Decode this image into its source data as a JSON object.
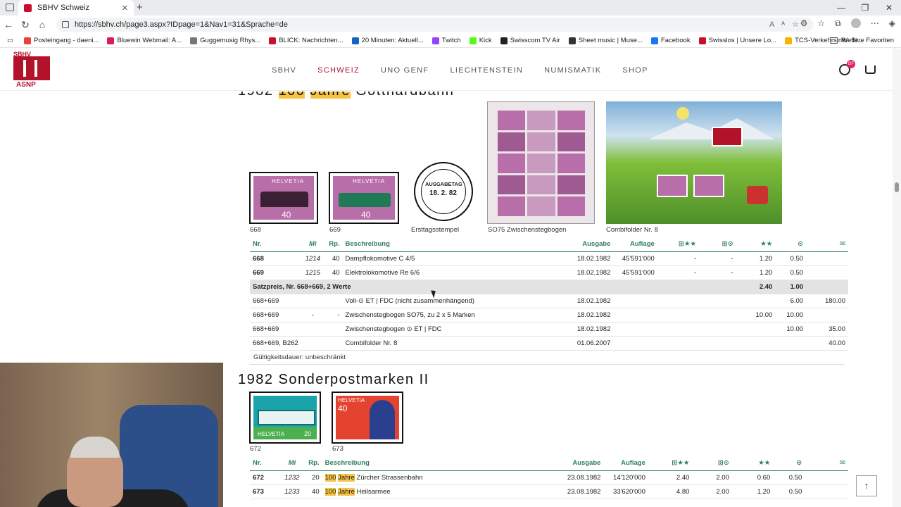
{
  "browser": {
    "tab_title": "SBHV Schweiz",
    "url": "https://sbhv.ch/page3.aspx?IDpage=1&Nav1=31&Sprache=de",
    "bookmarks": [
      "Posteingang - daeni...",
      "Bluewin Webmail: A...",
      "Guggemusig Rhys...",
      "BLICK: Nachrichten...",
      "20 Minuten: Aktuell...",
      "Twitch",
      "Kick",
      "Swisscom TV Air",
      "Sheet music | Muse...",
      "Facebook",
      "Swisslos | Unsere Lo...",
      "TCS-Verkehrsinfo: St..."
    ],
    "other_favorites": "Weitere Favoriten",
    "bookmark_colors": [
      "#ea4335",
      "#d81b60",
      "#777",
      "#c8102e",
      "#1565c0",
      "#9146ff",
      "#53fc18",
      "#222",
      "#333",
      "#1877f2",
      "#c8102e",
      "#f4b400"
    ]
  },
  "site": {
    "logo_top": "SBHV",
    "logo_bottom": "ASNP",
    "nav": [
      "SBHV",
      "SCHWEIZ",
      "UNO GENF",
      "LIECHTENSTEIN",
      "NUMISMATIK",
      "SHOP"
    ],
    "user_badge": "DF"
  },
  "section1": {
    "title_pre": "1982",
    "title_hl1": "100",
    "title_hl2": "Jahre",
    "title_post": "Gotthardbahn",
    "captions": [
      "668",
      "669",
      "Ersttagsstempel",
      "SO75 Zwischenstegbogen",
      "Combifolder Nr. 8"
    ],
    "stamp_text": "HELVETIA",
    "stamp_value": "40",
    "postmark_date": "18. 2. 82",
    "postmark_label": "AUSGABETAG",
    "headers": [
      "Nr.",
      "Mi",
      "Rp.",
      "Beschreibung",
      "Ausgabe",
      "Auflage",
      "⊞★★",
      "⊞⊙",
      "★★",
      "⊙",
      "✉"
    ],
    "rows": [
      [
        "668",
        "1214",
        "40",
        "Dampflokomotive C 4/5",
        "18.02.1982",
        "45'591'000",
        "-",
        "-",
        "1.20",
        "0.50",
        ""
      ],
      [
        "669",
        "1215",
        "40",
        "Elektrolokomotive Re 6/6",
        "18.02.1982",
        "45'591'000",
        "-",
        "-",
        "1.20",
        "0.50",
        ""
      ]
    ],
    "sum_label": "Satzpreis, Nr. 668+669, 2 Werte",
    "sum_mint": "2.40",
    "sum_used": "1.00",
    "extra_rows": [
      [
        "668+669",
        "",
        "",
        "Voll-⊙ ET | FDC (nicht zusammenhängend)",
        "18.02.1982",
        "",
        "",
        "",
        "",
        "6.00",
        "180.00"
      ],
      [
        "668+669",
        "-",
        "-",
        "Zwischenstegbogen SO75, zu 2 x 5 Marken",
        "18.02.1982",
        "",
        "",
        "",
        "10.00",
        "10.00",
        ""
      ],
      [
        "668+669",
        "",
        "",
        "Zwischenstegbogen ⊙ ET | FDC",
        "18.02.1982",
        "",
        "",
        "",
        "",
        "10.00",
        "35.00"
      ],
      [
        "668+669, B262",
        "",
        "",
        "Combifolder Nr. 8",
        "01.06.2007",
        "",
        "",
        "",
        "",
        "",
        "40.00"
      ]
    ],
    "validity": "Gültigkeitsdauer: unbeschränkt"
  },
  "section2": {
    "title": "1982 Sonderpostmarken II",
    "captions": [
      "672",
      "673"
    ],
    "stamp1_top": "HELVETIA",
    "stamp1_value": "20",
    "stamp2_top": "HELVETIA",
    "stamp2_value": "40",
    "headers": [
      "Nr.",
      "Mi",
      "Rp.",
      "Beschreibung",
      "Ausgabe",
      "Auflage",
      "⊞★★",
      "⊞⊙",
      "★★",
      "⊙",
      "✉"
    ],
    "rows": [
      {
        "nr": "672",
        "mi": "1232",
        "rp": "20",
        "hl1": "100",
        "hl2": "Jahre",
        "desc": "Zürcher Strassenbahn",
        "ausgabe": "23.08.1982",
        "auflage": "14'120'000",
        "c1": "2.40",
        "c2": "2.00",
        "c3": "0.60",
        "c4": "0.50",
        "c5": ""
      },
      {
        "nr": "673",
        "mi": "1233",
        "rp": "40",
        "hl1": "100",
        "hl2": "Jahre",
        "desc": "Heilsarmee",
        "ausgabe": "23.08.1982",
        "auflage": "33'620'000",
        "c1": "4.80",
        "c2": "2.00",
        "c3": "1.20",
        "c4": "0.50",
        "c5": ""
      }
    ]
  },
  "ui": {
    "to_top": "↑"
  }
}
